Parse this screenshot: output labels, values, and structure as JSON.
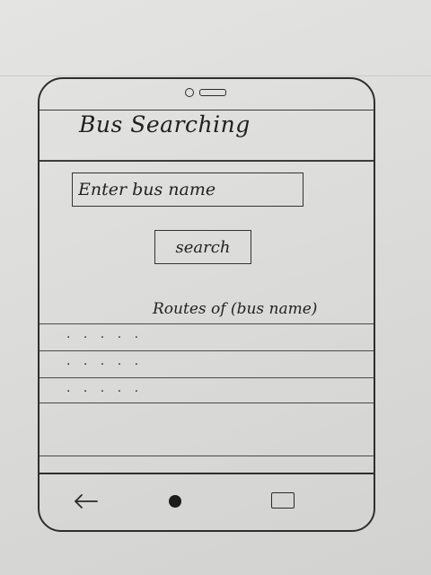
{
  "app": {
    "title": "Bus Searching"
  },
  "search": {
    "placeholder": "Enter bus name",
    "value": "",
    "button_label": "search"
  },
  "routes": {
    "heading": "Routes of (bus name)",
    "rows": [
      {
        "text": "· · · · ·"
      },
      {
        "text": "· · · · ·"
      },
      {
        "text": "· · · · ·"
      },
      {
        "text": ""
      }
    ]
  },
  "navigation": {
    "back_icon": "back-arrow-icon",
    "home_icon": "home-dot-icon",
    "recent_icon": "recent-apps-icon"
  }
}
